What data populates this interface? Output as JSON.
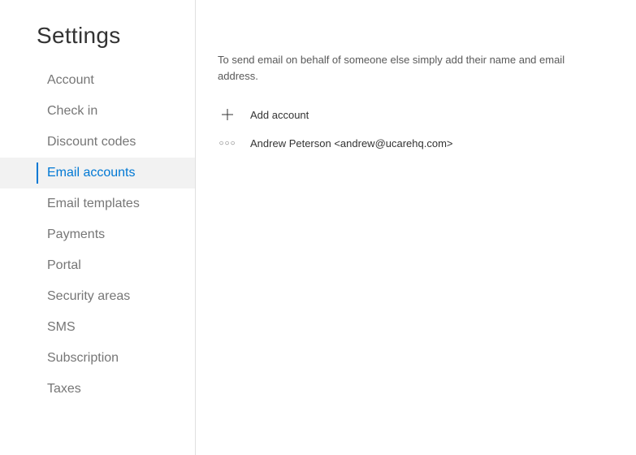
{
  "sidebar": {
    "title": "Settings",
    "items": [
      {
        "label": "Account",
        "active": false
      },
      {
        "label": "Check in",
        "active": false
      },
      {
        "label": "Discount codes",
        "active": false
      },
      {
        "label": "Email accounts",
        "active": true
      },
      {
        "label": "Email templates",
        "active": false
      },
      {
        "label": "Payments",
        "active": false
      },
      {
        "label": "Portal",
        "active": false
      },
      {
        "label": "Security areas",
        "active": false
      },
      {
        "label": "SMS",
        "active": false
      },
      {
        "label": "Subscription",
        "active": false
      },
      {
        "label": "Taxes",
        "active": false
      }
    ]
  },
  "main": {
    "description": "To send email on behalf of someone else simply add their name and email address.",
    "add_account_label": "Add account",
    "accounts": [
      {
        "display": "Andrew Peterson <andrew@ucarehq.com>"
      }
    ]
  }
}
